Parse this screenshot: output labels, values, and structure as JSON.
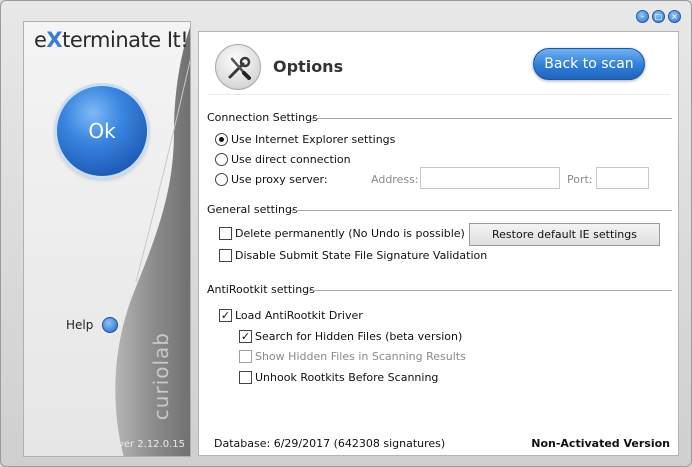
{
  "app": {
    "logo_prefix": "e",
    "logo_x": "X",
    "logo_suffix": "terminate It!",
    "version": "ver 2.12.0.15",
    "brand": "curiolab"
  },
  "left": {
    "ok_label": "Ok",
    "help_label": "Help"
  },
  "header": {
    "title": "Options",
    "back_label": "Back to scan",
    "icon": "wrench-screwdriver-icon"
  },
  "connection": {
    "title": "Connection Settings",
    "options": [
      {
        "label": "Use Internet Explorer settings",
        "selected": true
      },
      {
        "label": "Use direct connection",
        "selected": false
      },
      {
        "label": "Use proxy server:",
        "selected": false
      }
    ],
    "address_label": "Address:",
    "address_value": "",
    "port_label": "Port:",
    "port_value": ""
  },
  "general": {
    "title": "General settings",
    "delete_label": "Delete permanently (No Undo is possible)",
    "delete_checked": false,
    "disable_label": "Disable Submit State File Signature Validation",
    "disable_checked": false,
    "restore_label": "Restore default IE settings"
  },
  "antirootkit": {
    "title": "AntiRootkit settings",
    "load_label": "Load AntiRootkit Driver",
    "load_checked": true,
    "hidden_label": "Search for Hidden Files (beta version)",
    "hidden_checked": true,
    "show_label": "Show Hidden Files in Scanning Results",
    "show_checked": false,
    "unhook_label": "Unhook Rootkits Before Scanning",
    "unhook_checked": false
  },
  "footer": {
    "database": "Database: 6/29/2017 (642308 signatures)",
    "status": "Non-Activated Version"
  },
  "colors": {
    "accent": "#2f7ed8",
    "panel_dark": "#8f8f8f"
  }
}
